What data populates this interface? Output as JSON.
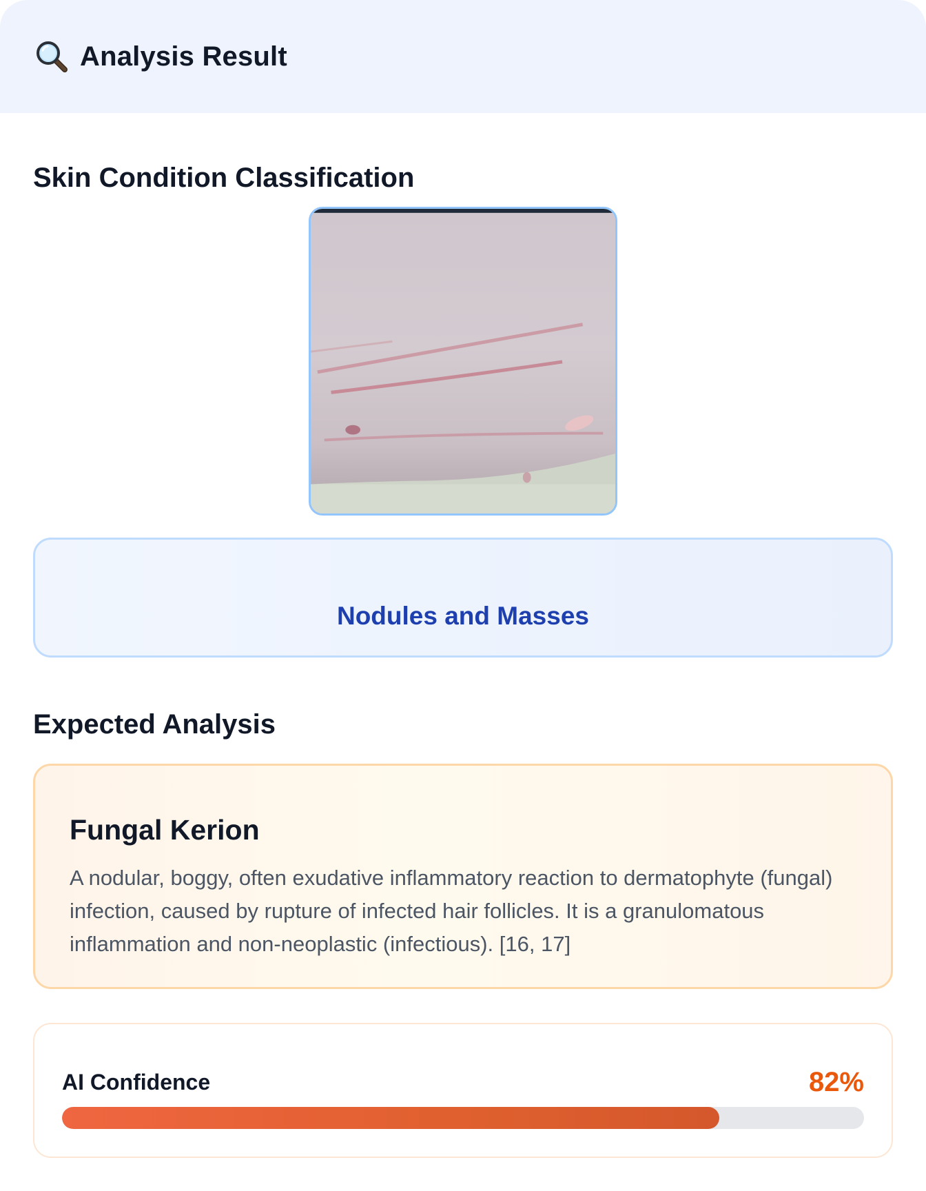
{
  "header": {
    "icon": "magnifier-icon",
    "title": "Analysis Result"
  },
  "classification": {
    "section_title": "Skin Condition Classification",
    "label": "Nodules and Masses"
  },
  "analysis": {
    "section_title": "Expected Analysis",
    "title": "Fungal Kerion",
    "description": "A nodular, boggy, often exudative inflammatory reaction to dermatophyte (fungal) infection, caused by rupture of infected hair follicles. It is a granulomatous inflammation and non-neoplastic (infectious). [16, 17]"
  },
  "confidence": {
    "label": "AI Confidence",
    "value_text": "82%",
    "value": 0.82
  },
  "colors": {
    "header_bg": "#eef3fd",
    "class_label": "#1e40af",
    "confidence_accent": "#ea580c"
  }
}
